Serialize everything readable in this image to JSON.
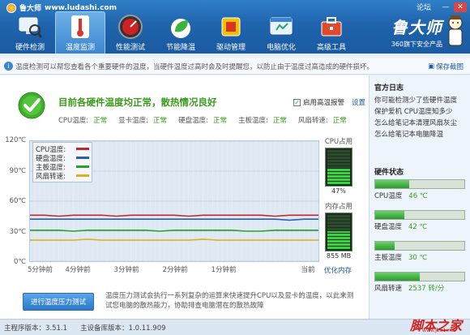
{
  "window": {
    "app_name": "鲁大师",
    "url": "www.ludashi.com",
    "forum_label": "论坛",
    "minimize": "—",
    "close": "✕"
  },
  "toolbar": [
    {
      "label": "硬件检测",
      "icon": "monitor-magnifier-icon",
      "active": false
    },
    {
      "label": "温度监测",
      "icon": "thermometer-icon",
      "active": true
    },
    {
      "label": "性能测试",
      "icon": "speedometer-icon",
      "active": false
    },
    {
      "label": "节能降温",
      "icon": "leaf-icon",
      "active": false
    },
    {
      "label": "驱动管理",
      "icon": "chip-icon",
      "active": false
    },
    {
      "label": "电脑优化",
      "icon": "window-optimize-icon",
      "active": false
    },
    {
      "label": "高级工具",
      "icon": "toolbox-icon",
      "active": false
    }
  ],
  "brand": {
    "name": "鲁大师",
    "slogan": "360旗下安全产品"
  },
  "infobar": {
    "text": "温度检测可以帮您查看各个重要硬件的温度，当硬件温度过高时会及时提醒您，以防止由于温度过高造成的硬件损坏。",
    "save_label": "保存截图"
  },
  "status": {
    "title": "目前各硬件温度均正常，散热情况良好",
    "alarm_label": "启用高温报警",
    "alarm_checked": true,
    "settings_label": "设置"
  },
  "temps": [
    {
      "label": "CPU温度:",
      "value": "正常"
    },
    {
      "label": "显卡温度:",
      "value": "正常"
    },
    {
      "label": "硬盘温度:",
      "value": "正常"
    },
    {
      "label": "主板温度:",
      "value": "正常"
    },
    {
      "label": "风扇转速:",
      "value": "正常"
    }
  ],
  "meters": {
    "cpu_title": "CPU占用",
    "cpu_value": "47%",
    "cpu_fraction": 0.47,
    "mem_title": "内存占用",
    "mem_value": "855 MB",
    "mem_fraction": 0.55,
    "optimize_label": "优化内存"
  },
  "stress": {
    "button_label": "进行温度压力测试",
    "description": "温度压力测试会执行一系列复杂的运算来快速提升CPU以及显卡的温度，以此来测试您电脑的散热能力，协助排查电脑潜在的散热故障"
  },
  "news": {
    "title": "官方日志",
    "items": [
      "你可能检测少了些硬件温度",
      "保护爱机 CPU温度知多少",
      "怎么给笔记本清理风扇灰尘",
      "怎么给笔记本电脑降温"
    ]
  },
  "hardware": {
    "title": "硬件状态",
    "items": [
      {
        "label": "CPU温度",
        "value": "46 ℃",
        "fraction": 0.38
      },
      {
        "label": "硬盘温度",
        "value": "42 ℃",
        "fraction": 0.33
      },
      {
        "label": "主板温度",
        "value": "30 ℃",
        "fraction": 0.22
      },
      {
        "label": "风扇转速",
        "value": "2537 转/分",
        "fraction": 0.5
      }
    ]
  },
  "statusbar": {
    "main_version": "主程序版本：3.51.1",
    "db_version": "主设备库版本：1.0.11.909"
  },
  "watermark": {
    "text": "脚本之家",
    "sub": "www.jb51.net"
  },
  "chart_data": {
    "type": "line",
    "ylim": [
      0,
      120
    ],
    "yticks": [
      "120℃",
      "90℃",
      "60℃",
      "30℃",
      "0℃"
    ],
    "x": [
      "5分钟前",
      "4分钟前",
      "3分钟前",
      "2分钟前",
      "1分钟前",
      "当前"
    ],
    "legend_position": "top-left",
    "series": [
      {
        "name": "CPU温度:",
        "color": "#c0282b",
        "values": [
          46,
          46,
          45,
          46,
          46,
          46,
          45,
          46,
          46,
          46,
          46,
          45,
          46,
          46,
          46,
          46,
          46,
          45,
          46,
          46,
          46
        ]
      },
      {
        "name": "硬盘温度:",
        "color": "#2a5db5",
        "values": [
          42,
          42,
          42,
          42,
          42,
          42,
          42,
          42,
          42,
          42,
          42,
          42,
          42,
          42,
          42,
          42,
          42,
          42,
          41,
          42,
          42
        ]
      },
      {
        "name": "主板温度:",
        "color": "#2aa12a",
        "values": [
          31,
          31,
          31,
          30,
          31,
          31,
          31,
          31,
          31,
          30,
          31,
          31,
          31,
          31,
          31,
          30,
          30,
          31,
          31,
          31,
          31
        ]
      },
      {
        "name": "风扇转速:",
        "color": "#e0b020",
        "values": [
          21,
          21,
          21,
          21,
          22,
          21,
          21,
          21,
          21,
          21,
          21,
          21,
          22,
          21,
          21,
          21,
          21,
          21,
          21,
          21,
          21
        ]
      }
    ]
  }
}
